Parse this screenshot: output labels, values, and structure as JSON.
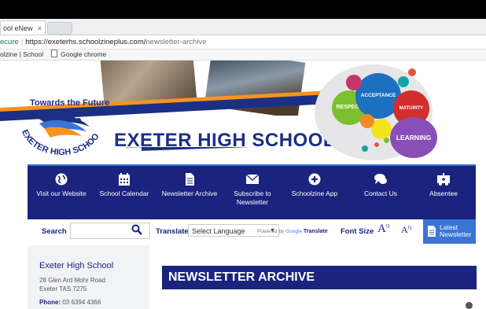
{
  "browser": {
    "tab_title": "ool eNew",
    "tab_close": "×",
    "address": {
      "security": "ecure",
      "host": "https://exeterhs.schoolzineplus.com/",
      "path": "newsletter-archive"
    },
    "bookmarks": [
      "olzine | School",
      "Google chrome"
    ]
  },
  "banner": {
    "tagline": "Towards the Future",
    "emblem_text": "EXETER HIGH SCHOOL",
    "title": "EXETER HIGH SCHOOL",
    "values": [
      "ACCEPTANCE",
      "RESPECT",
      "MATURITY",
      "LEARNING"
    ]
  },
  "nav": {
    "items": [
      {
        "label": "Visit our Website",
        "icon": "globe-icon"
      },
      {
        "label": "School Calendar",
        "icon": "calendar-icon"
      },
      {
        "label": "Newsletter Archive",
        "icon": "document-icon"
      },
      {
        "label": "Subscribe to Newsletter",
        "icon": "envelope-icon"
      },
      {
        "label": "Schoolzine App",
        "icon": "plus-circle-icon"
      },
      {
        "label": "Contact Us",
        "icon": "chat-icon"
      },
      {
        "label": "Absentee",
        "icon": "absentee-icon"
      }
    ]
  },
  "toolbar": {
    "search_label": "Search",
    "search_value": "",
    "translate_label": "Translate",
    "select_language": "Select Language",
    "select_arrow": "▼",
    "powered_by": "Powered by",
    "google": "Google",
    "translate_brand": "Translate",
    "font_size_label": "Font Size",
    "font_large": "A",
    "font_small": "A",
    "font_mark": "Q",
    "latest_newsletter": "Latest Newsletter"
  },
  "sidebar": {
    "school_name": "Exeter High School",
    "address_line1": "28 Glen Ard Mohr Road",
    "address_line2": "Exeter TAS 7275",
    "phone_label": "Phone:",
    "phone_value": "03 6394 4366"
  },
  "main": {
    "title": "NEWSLETTER ARCHIVE"
  },
  "colors": {
    "navy": "#1a237e",
    "accent_blue": "#3b74d6",
    "orange": "#f7931e"
  }
}
